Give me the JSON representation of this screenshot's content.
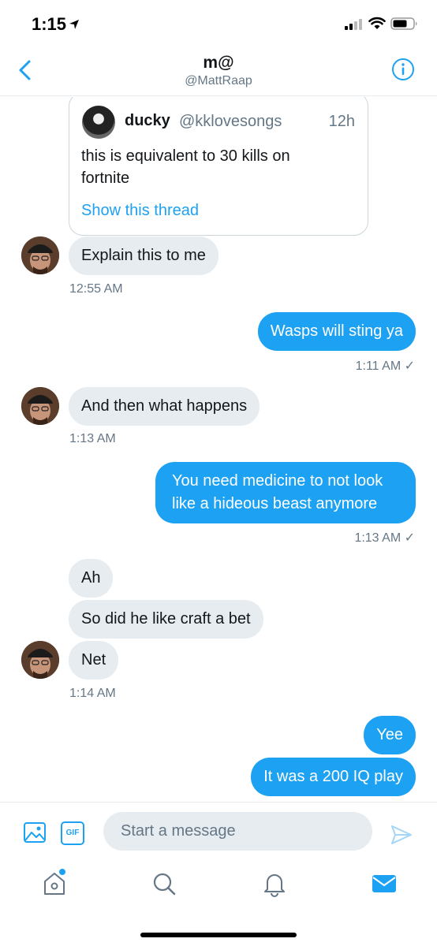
{
  "status_bar": {
    "time": "1:15"
  },
  "header": {
    "name": "m@",
    "handle": "@MattRaap"
  },
  "quoted_tweet": {
    "name": "ducky",
    "handle": "@kklovesongs",
    "time": "12h",
    "text": "this is equivalent to 30 kills on fortnite",
    "link_label": "Show this thread"
  },
  "messages": [
    {
      "text": "Explain this to me",
      "direction": "in"
    },
    {
      "text": "Wasps will sting ya",
      "direction": "out"
    },
    {
      "text": "And then what happens",
      "direction": "in"
    },
    {
      "text": "You need medicine to not look like a hideous beast anymore",
      "direction": "out"
    },
    {
      "text": "Ah",
      "direction": "in"
    },
    {
      "text": "So did he like craft a bet",
      "direction": "in"
    },
    {
      "text": "Net",
      "direction": "in"
    },
    {
      "text": "Yee",
      "direction": "out"
    },
    {
      "text": "It was a 200 IQ play",
      "direction": "out"
    }
  ],
  "timestamps": [
    "12:55 AM",
    "1:11 AM ✓",
    "1:13 AM",
    "1:13 AM ✓",
    "1:14 AM"
  ],
  "composer": {
    "placeholder": "Start a message",
    "gif_label": "GIF"
  },
  "icons": {
    "back": "chevron-left-icon",
    "info": "info-icon",
    "media": "image-icon",
    "send": "send-icon",
    "tabs": [
      "home-icon",
      "search-icon",
      "bell-icon",
      "mail-icon"
    ]
  },
  "colors": {
    "accent": "#1da1f2",
    "incoming_bubble": "#e6ecf0",
    "secondary_text": "#657786"
  }
}
